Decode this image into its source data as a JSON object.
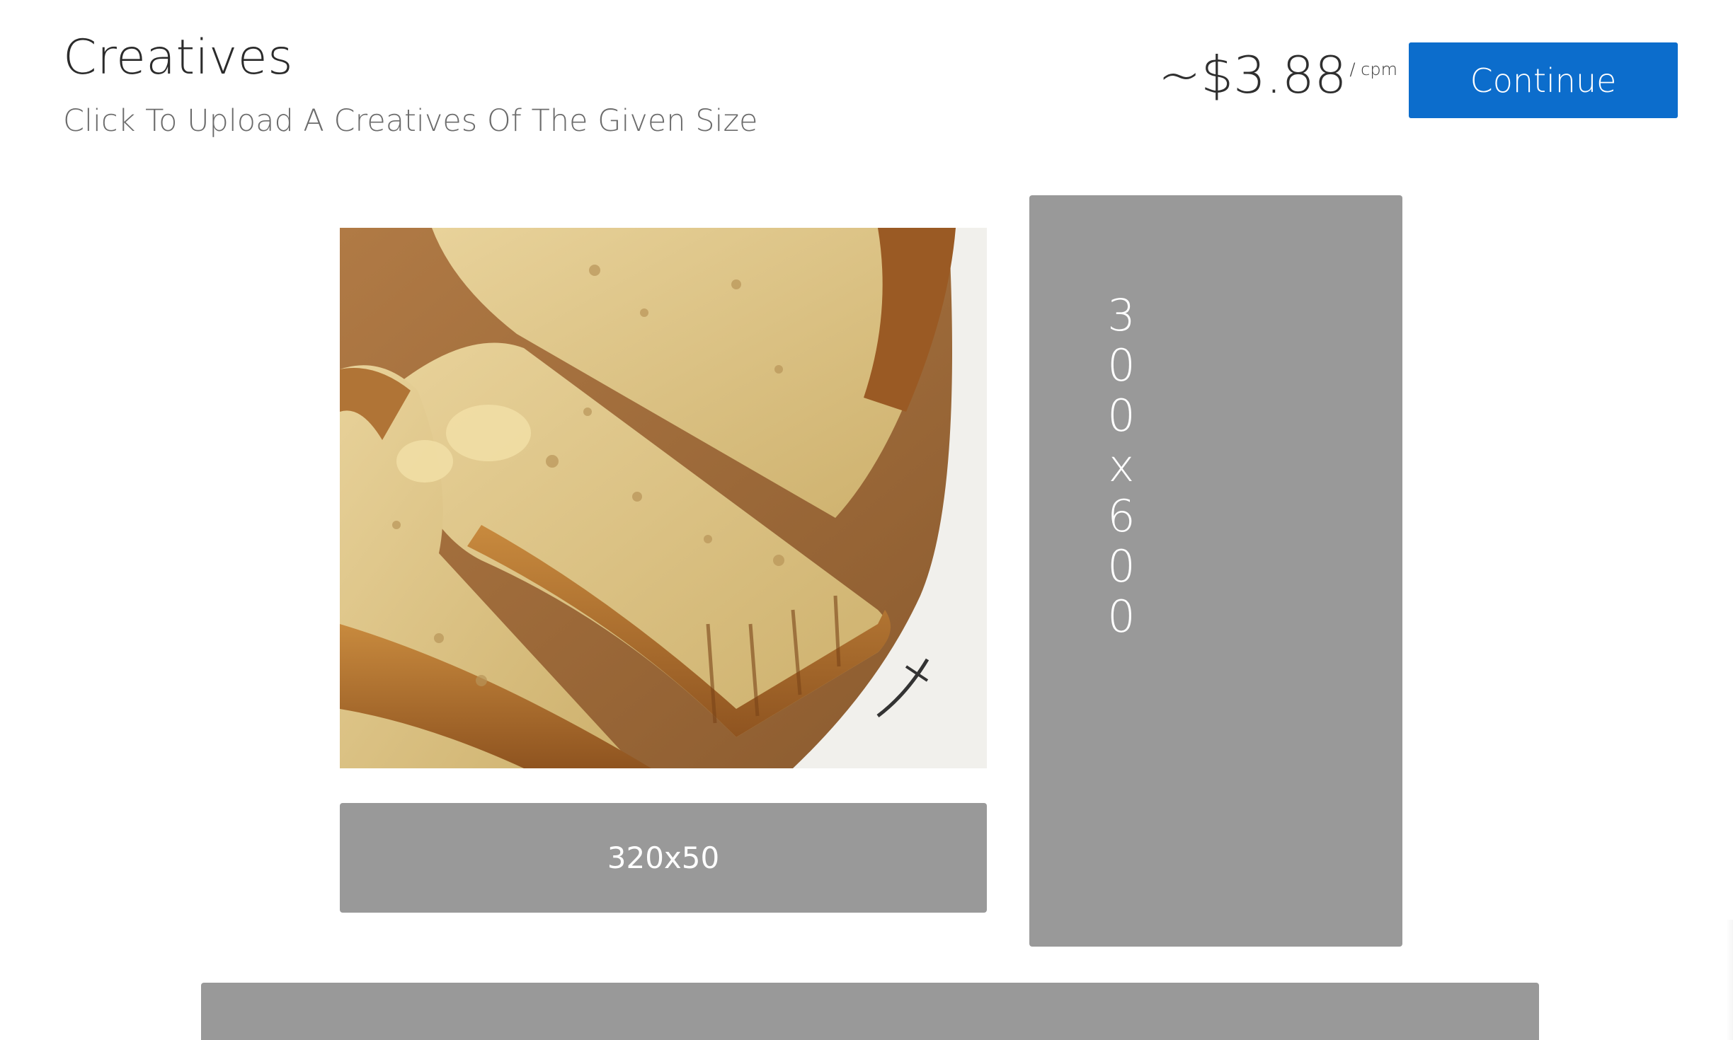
{
  "header": {
    "title": "Creatives",
    "subtitle": "Click To Upload A Creatives Of The Given Size"
  },
  "pricing": {
    "amount": "~$3.88",
    "unit": "/ cpm"
  },
  "actions": {
    "continue_label": "Continue"
  },
  "creatives": {
    "uploaded_image_icon": "banana-bread-photo",
    "slot_320x50": "320x50",
    "slot_300x600_chars": [
      "3",
      "0",
      "0",
      "x",
      "6",
      "0",
      "0"
    ]
  },
  "colors": {
    "accent": "#0c6dcc",
    "slot_bg": "#999999",
    "text_dark": "#2b2b2b",
    "text_muted": "#6b6b6b"
  }
}
